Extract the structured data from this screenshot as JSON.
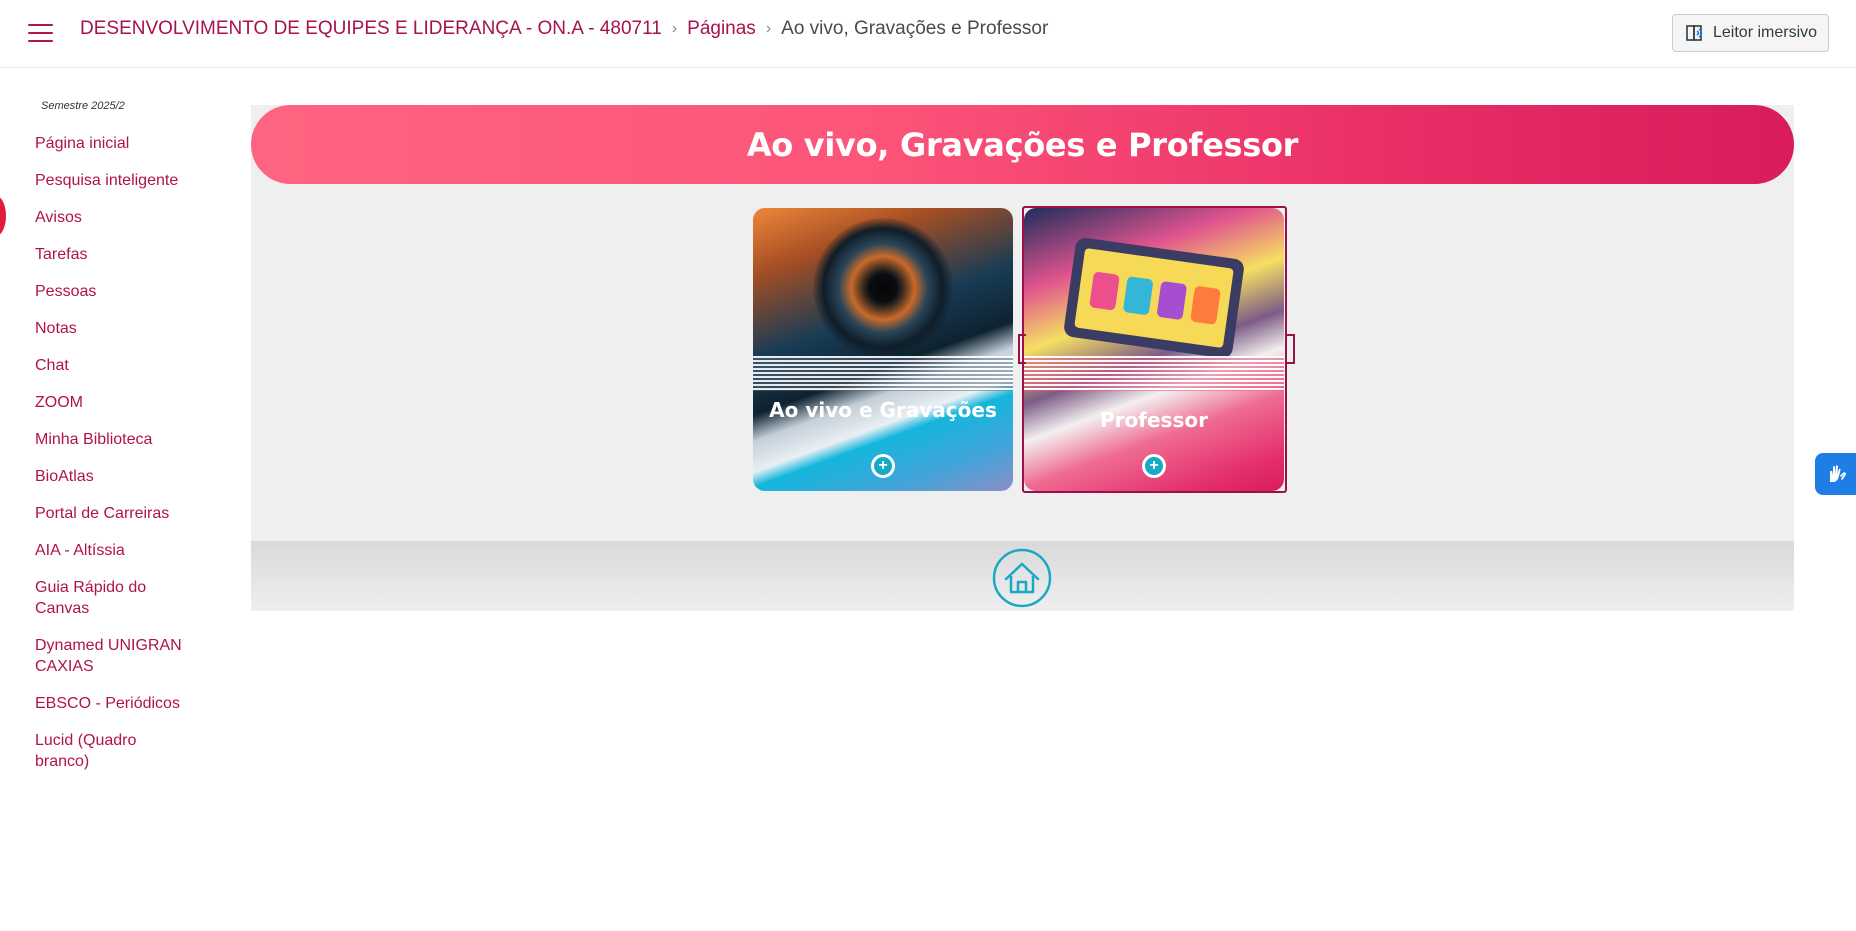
{
  "header": {
    "course_title": "DESENVOLVIMENTO DE EQUIPES E LIDERANÇA - ON.A - 480711",
    "breadcrumb_pages": "Páginas",
    "breadcrumb_current": "Ao vivo, Gravações e Professor",
    "separator": "›",
    "immersive_reader_label": "Leitor imersivo"
  },
  "sidebar": {
    "semester": "Semestre 2025/2",
    "items": [
      {
        "label": "Página inicial"
      },
      {
        "label": "Pesquisa inteligente"
      },
      {
        "label": "Avisos"
      },
      {
        "label": "Tarefas"
      },
      {
        "label": "Pessoas"
      },
      {
        "label": "Notas"
      },
      {
        "label": "Chat"
      },
      {
        "label": "ZOOM"
      },
      {
        "label": "Minha Biblioteca"
      },
      {
        "label": "BioAtlas"
      },
      {
        "label": "Portal de Carreiras"
      },
      {
        "label": "AIA - Altíssia"
      },
      {
        "label": "Guia Rápido do Canvas"
      },
      {
        "label": "Dynamed UNIGRAN CAXIAS"
      },
      {
        "label": "EBSCO - Periódicos"
      },
      {
        "label": "Lucid (Quadro branco)"
      }
    ]
  },
  "main": {
    "banner_title": "Ao vivo, Gravações e Professor",
    "cards": [
      {
        "title": "Ao vivo e Gravações",
        "icon": "plus-circle-icon"
      },
      {
        "title": "Professor",
        "icon": "plus-circle-icon"
      }
    ],
    "home_icon": "home-icon"
  },
  "colors": {
    "brand": "#b0124e",
    "banner_start": "#fe6481",
    "banner_end": "#d91c5b",
    "accent_cyan": "#17a9c6",
    "vlibras_blue": "#1f7ee6"
  }
}
